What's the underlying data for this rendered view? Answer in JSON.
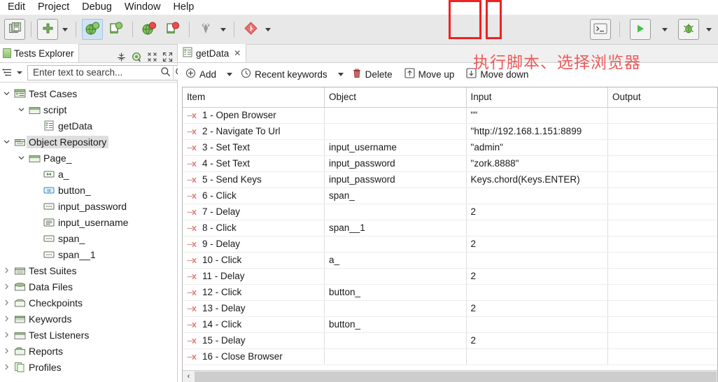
{
  "menubar": {
    "items": [
      "Edit",
      "Project",
      "Debug",
      "Window",
      "Help"
    ]
  },
  "toolbar": {
    "buttons": [
      {
        "name": "save-all-icon",
        "label": "Save All"
      },
      {
        "name": "new-item-icon",
        "label": "New"
      },
      {
        "name": "new-dropdown-caret",
        "label": ""
      },
      {
        "name": "record-web-icon",
        "label": "Record Web"
      },
      {
        "name": "record-mobile-icon",
        "label": "Record Mobile"
      },
      {
        "name": "spy-web-icon",
        "label": "Spy Web"
      },
      {
        "name": "spy-mobile-icon",
        "label": "Spy Mobile"
      },
      {
        "name": "katalon-store-icon",
        "label": "Katalon Store"
      },
      {
        "name": "store-dropdown-caret",
        "label": ""
      },
      {
        "name": "git-icon",
        "label": "Git"
      },
      {
        "name": "git-dropdown-caret",
        "label": ""
      },
      {
        "name": "console-icon",
        "label": "Console"
      },
      {
        "name": "run-icon",
        "label": "Run"
      },
      {
        "name": "run-dropdown-caret",
        "label": ""
      },
      {
        "name": "debug-icon",
        "label": "Debug"
      },
      {
        "name": "debug-dropdown-caret",
        "label": ""
      }
    ]
  },
  "annotation": {
    "text": "执行脚本、选择浏览器",
    "color": "#ef5a5a"
  },
  "highlight": {
    "color": "#ee2222"
  },
  "tests_explorer": {
    "tab_label": "Tests Explorer",
    "tools": [
      "collapse-all-icon",
      "link-with-editor-icon",
      "minimize-icon",
      "maximize-icon"
    ],
    "search": {
      "placeholder": "Enter text to search...",
      "value": ""
    },
    "tree": [
      {
        "label": "Test Cases",
        "depth": 0,
        "twist": "down",
        "icon": "test-cases-icon",
        "selected": false
      },
      {
        "label": "script",
        "depth": 1,
        "twist": "down",
        "icon": "folder-icon",
        "selected": false
      },
      {
        "label": "getData",
        "depth": 2,
        "twist": "none",
        "icon": "test-case-icon",
        "selected": false
      },
      {
        "label": "Object Repository",
        "depth": 0,
        "twist": "down",
        "icon": "object-repository-icon",
        "selected": true
      },
      {
        "label": "Page_",
        "depth": 1,
        "twist": "down",
        "icon": "folder-icon",
        "selected": false
      },
      {
        "label": "a_",
        "depth": 2,
        "twist": "none",
        "icon": "link-object-icon",
        "selected": false
      },
      {
        "label": "button_",
        "depth": 2,
        "twist": "none",
        "icon": "button-object-icon",
        "selected": false
      },
      {
        "label": "input_password",
        "depth": 2,
        "twist": "none",
        "icon": "input-object-icon",
        "selected": false
      },
      {
        "label": "input_username",
        "depth": 2,
        "twist": "none",
        "icon": "textarea-object-icon",
        "selected": false
      },
      {
        "label": "span_",
        "depth": 2,
        "twist": "none",
        "icon": "span-object-icon",
        "selected": false
      },
      {
        "label": "span__1",
        "depth": 2,
        "twist": "none",
        "icon": "span-object-icon",
        "selected": false
      },
      {
        "label": "Test Suites",
        "depth": 0,
        "twist": "right",
        "icon": "test-suites-icon",
        "selected": false
      },
      {
        "label": "Data Files",
        "depth": 0,
        "twist": "right",
        "icon": "data-files-icon",
        "selected": false
      },
      {
        "label": "Checkpoints",
        "depth": 0,
        "twist": "right",
        "icon": "checkpoints-icon",
        "selected": false
      },
      {
        "label": "Keywords",
        "depth": 0,
        "twist": "right",
        "icon": "keywords-icon",
        "selected": false
      },
      {
        "label": "Test Listeners",
        "depth": 0,
        "twist": "right",
        "icon": "test-listeners-icon",
        "selected": false
      },
      {
        "label": "Reports",
        "depth": 0,
        "twist": "right",
        "icon": "reports-icon",
        "selected": false
      },
      {
        "label": "Profiles",
        "depth": 0,
        "twist": "right",
        "icon": "profiles-icon",
        "selected": false
      }
    ]
  },
  "editor": {
    "tab": {
      "label": "getData",
      "close_label": "✕"
    },
    "toolbar": {
      "add_label": "Add",
      "recent_keywords_label": "Recent keywords",
      "delete_label": "Delete",
      "move_up_label": "Move up",
      "move_down_label": "Move down"
    },
    "table": {
      "columns": [
        "Item",
        "Object",
        "Input",
        "Output"
      ],
      "rows": [
        {
          "item": "1 - Open Browser",
          "object": "",
          "input": "\"\"",
          "output": ""
        },
        {
          "item": "2 - Navigate To Url",
          "object": "",
          "input": "\"http://192.168.1.151:8899",
          "output": ""
        },
        {
          "item": "3 - Set Text",
          "object": "input_username",
          "input": "\"admin\"",
          "output": ""
        },
        {
          "item": "4 - Set Text",
          "object": "input_password",
          "input": "\"zork.8888\"",
          "output": ""
        },
        {
          "item": "5 - Send Keys",
          "object": "input_password",
          "input": "Keys.chord(Keys.ENTER)",
          "output": ""
        },
        {
          "item": "6 - Click",
          "object": "span_",
          "input": "",
          "output": ""
        },
        {
          "item": "7 - Delay",
          "object": "",
          "input": "2",
          "output": ""
        },
        {
          "item": "8 - Click",
          "object": "span__1",
          "input": "",
          "output": ""
        },
        {
          "item": "9 - Delay",
          "object": "",
          "input": "2",
          "output": ""
        },
        {
          "item": "10 - Click",
          "object": "a_",
          "input": "",
          "output": ""
        },
        {
          "item": "11 - Delay",
          "object": "",
          "input": "2",
          "output": ""
        },
        {
          "item": "12 - Click",
          "object": "button_",
          "input": "",
          "output": ""
        },
        {
          "item": "13 - Delay",
          "object": "",
          "input": "2",
          "output": ""
        },
        {
          "item": "14 - Click",
          "object": "button_",
          "input": "",
          "output": ""
        },
        {
          "item": "15 - Delay",
          "object": "",
          "input": "2",
          "output": ""
        },
        {
          "item": "16 - Close Browser",
          "object": "",
          "input": "",
          "output": ""
        }
      ]
    },
    "scrollbar": {
      "left_arrow": "‹"
    }
  }
}
